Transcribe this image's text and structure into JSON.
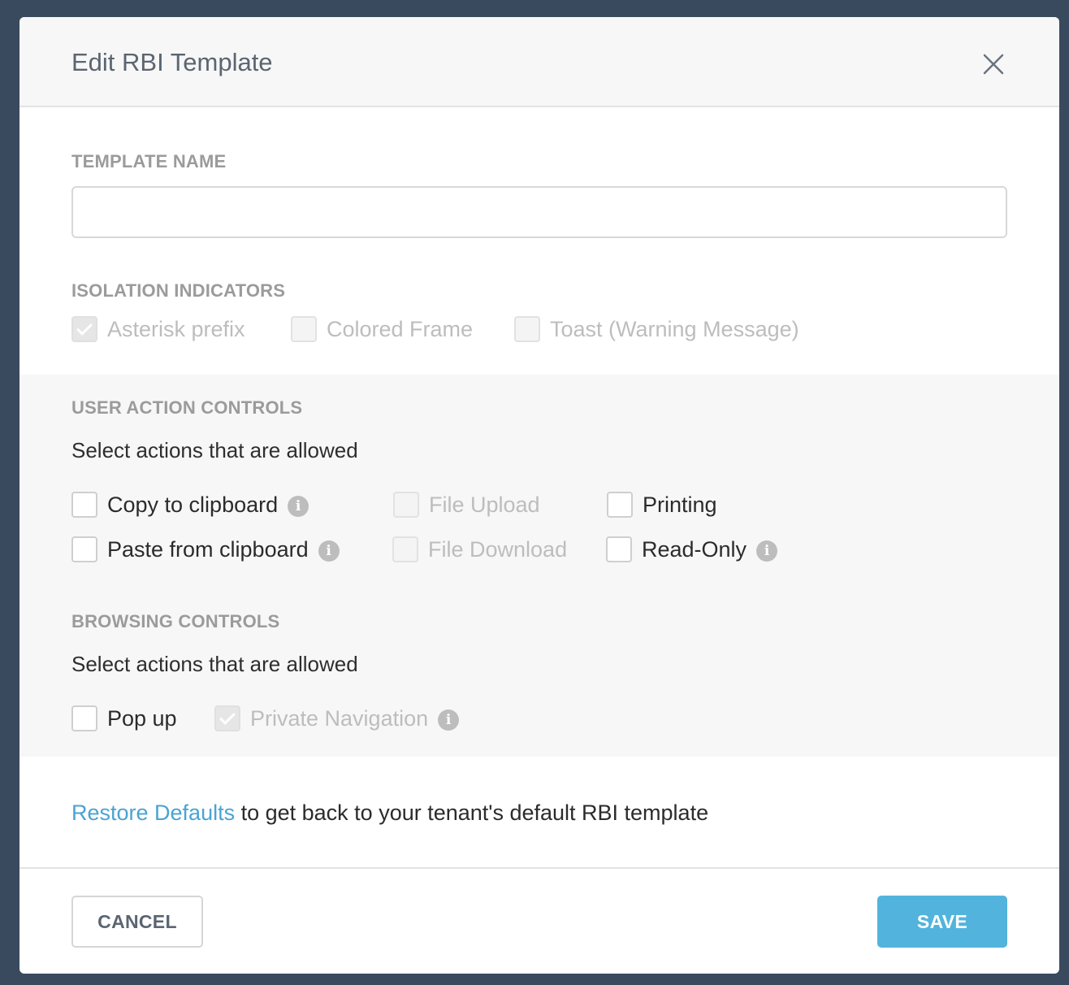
{
  "modal": {
    "title": "Edit RBI Template",
    "close_icon": "close-icon"
  },
  "template_name": {
    "label": "TEMPLATE NAME",
    "value": "",
    "placeholder": ""
  },
  "isolation_indicators": {
    "label": "ISOLATION INDICATORS",
    "options": [
      {
        "label": "Asterisk prefix",
        "checked": true,
        "disabled": true
      },
      {
        "label": "Colored Frame",
        "checked": false,
        "disabled": true
      },
      {
        "label": "Toast (Warning Message)",
        "checked": false,
        "disabled": true
      }
    ]
  },
  "user_action_controls": {
    "label": "USER ACTION CONTROLS",
    "subtitle": "Select actions that are allowed",
    "options": [
      {
        "label": "Copy to clipboard",
        "checked": false,
        "disabled": false,
        "info": true
      },
      {
        "label": "File Upload",
        "checked": false,
        "disabled": true,
        "info": false
      },
      {
        "label": "Printing",
        "checked": false,
        "disabled": false,
        "info": false
      },
      {
        "label": "Paste from clipboard",
        "checked": false,
        "disabled": false,
        "info": true
      },
      {
        "label": "File Download",
        "checked": false,
        "disabled": true,
        "info": false
      },
      {
        "label": "Read-Only",
        "checked": false,
        "disabled": false,
        "info": true
      }
    ]
  },
  "browsing_controls": {
    "label": "BROWSING CONTROLS",
    "subtitle": "Select actions that are allowed",
    "options": [
      {
        "label": "Pop up",
        "checked": false,
        "disabled": false,
        "info": false
      },
      {
        "label": "Private Navigation",
        "checked": true,
        "disabled": true,
        "info": true
      }
    ]
  },
  "restore": {
    "link_text": "Restore Defaults",
    "suffix_text": " to get back to your tenant's default RBI template"
  },
  "footer": {
    "cancel_label": "CANCEL",
    "save_label": "SAVE"
  },
  "icons": {
    "info_glyph": "i"
  },
  "colors": {
    "accent": "#52b4dc",
    "link": "#4aa3d3",
    "backdrop": "#3a4a5e"
  }
}
